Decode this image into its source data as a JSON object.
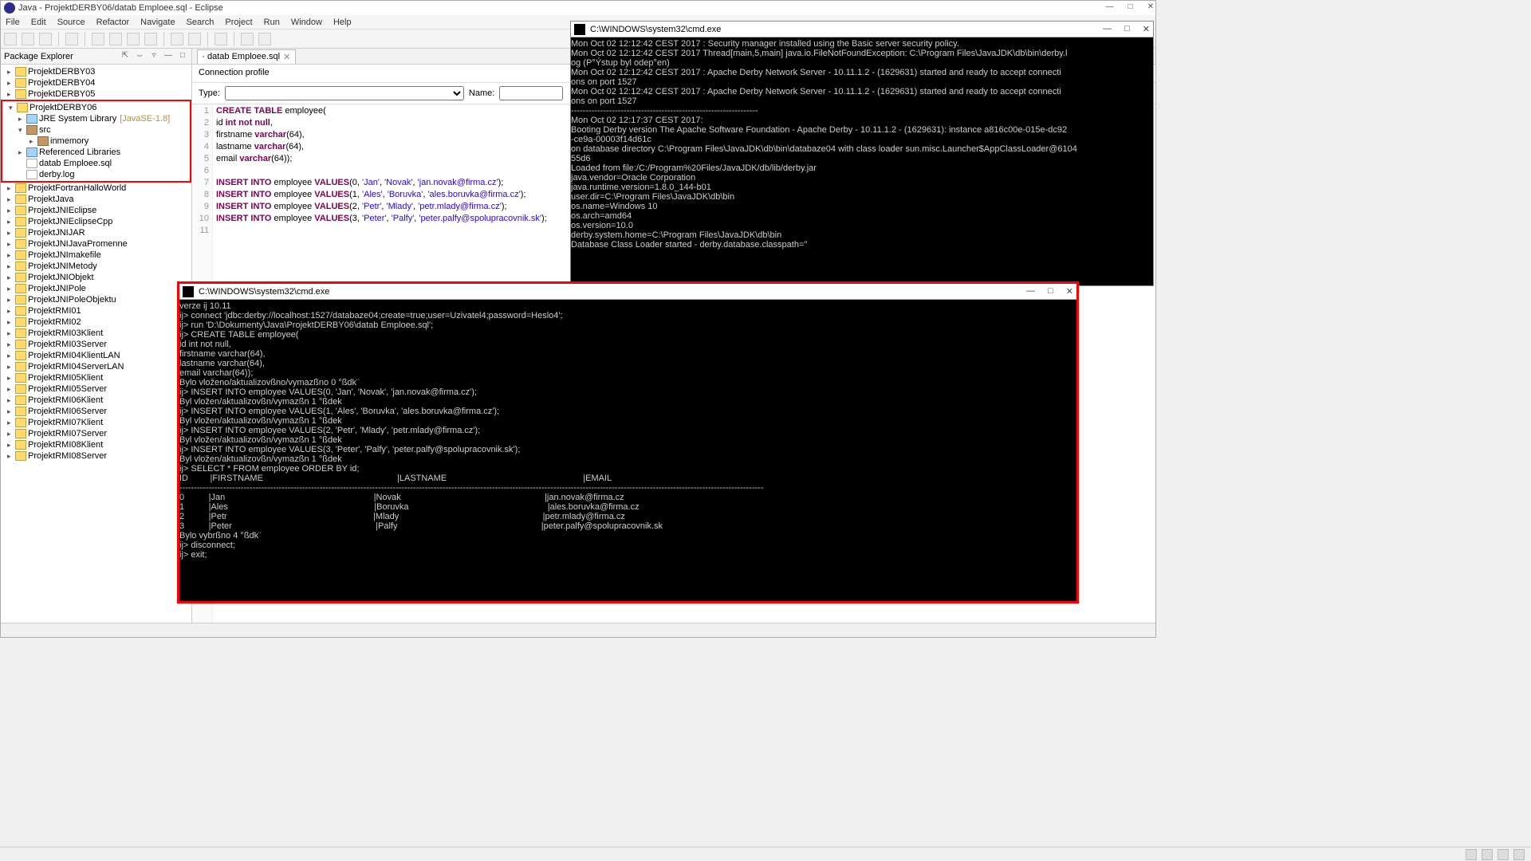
{
  "eclipse": {
    "title": "Java - ProjektDERBY06/datab Emploee.sql - Eclipse",
    "menus": [
      "File",
      "Edit",
      "Source",
      "Refactor",
      "Navigate",
      "Search",
      "Project",
      "Run",
      "Window",
      "Help"
    ],
    "pkgExplorer": {
      "title": "Package Explorer",
      "projects": [
        {
          "name": "ProjektDERBY03"
        },
        {
          "name": "ProjektDERBY04"
        },
        {
          "name": "ProjektDERBY05"
        }
      ],
      "highlighted": {
        "name": "ProjektDERBY06",
        "jre": "JRE System Library",
        "jreVers": "[JavaSE-1.8]",
        "src": "src",
        "pkg": "inmemory",
        "ref": "Referenced Libraries",
        "sql": "datab Emploee.sql",
        "log": "derby.log"
      },
      "rest": [
        "ProjektFortranHalloWorld",
        "ProjektJava",
        "ProjektJNIEclipse",
        "ProjektJNIEclipseCpp",
        "ProjektJNIJAR",
        "ProjektJNIJavaPromenne",
        "ProjektJNImakefile",
        "ProjektJNIMetody",
        "ProjektJNIObjekt",
        "ProjektJNIPole",
        "ProjektJNIPoleObjektu",
        "ProjektRMI01",
        "ProjektRMI02",
        "ProjektRMI03Klient",
        "ProjektRMI03Server",
        "ProjektRMI04KlientLAN",
        "ProjektRMI04ServerLAN",
        "ProjektRMI05Klient",
        "ProjektRMI05Server",
        "ProjektRMI06Klient",
        "ProjektRMI06Server",
        "ProjektRMI07Klient",
        "ProjektRMI07Server",
        "ProjektRMI08Klient",
        "ProjektRMI08Server"
      ]
    },
    "editor": {
      "tabName": "datab Emploee.sql",
      "connProfile": "Connection profile",
      "typeLabel": "Type:",
      "nameLabel": "Name:",
      "code": [
        {
          "n": 1,
          "l": "CREATE TABLE employee("
        },
        {
          "n": 2,
          "l": "id int not null,"
        },
        {
          "n": 3,
          "l": "firstname varchar(64),"
        },
        {
          "n": 4,
          "l": "lastname varchar(64),"
        },
        {
          "n": 5,
          "l": "email varchar(64));"
        },
        {
          "n": 6,
          "l": ""
        },
        {
          "n": 7,
          "l": "INSERT INTO employee VALUES(0, 'Jan', 'Novak', 'jan.novak@firma.cz');"
        },
        {
          "n": 8,
          "l": "INSERT INTO employee VALUES(1, 'Ales', 'Boruvka', 'ales.boruvka@firma.cz');"
        },
        {
          "n": 9,
          "l": "INSERT INTO employee VALUES(2, 'Petr', 'Mlady', 'petr.mlady@firma.cz');"
        },
        {
          "n": 10,
          "l": "INSERT INTO employee VALUES(3, 'Peter', 'Palfy', 'peter.palfy@spolupracovnik.sk');"
        },
        {
          "n": 11,
          "l": ""
        }
      ]
    }
  },
  "termTop": {
    "title": "C:\\WINDOWS\\system32\\cmd.exe",
    "lines": [
      "Mon Oct 02 12:12:42 CEST 2017 : Security manager installed using the Basic server security policy.",
      "Mon Oct 02 12:12:42 CEST 2017 Thread[main,5,main] java.io.FileNotFoundException: C:\\Program Files\\JavaJDK\\db\\bin\\derby.l",
      "og (P°Ýstup byl odep°en)",
      "Mon Oct 02 12:12:42 CEST 2017 : Apache Derby Network Server - 10.11.1.2 - (1629631) started and ready to accept connecti",
      "ons on port 1527",
      "Mon Oct 02 12:12:42 CEST 2017 : Apache Derby Network Server - 10.11.1.2 - (1629631) started and ready to accept connecti",
      "ons on port 1527",
      "----------------------------------------------------------------",
      "Mon Oct 02 12:17:37 CEST 2017:",
      "Booting Derby version The Apache Software Foundation - Apache Derby - 10.11.1.2 - (1629631): instance a816c00e-015e-dc92",
      "-ce9a-00003f14d61c",
      "on database directory C:\\Program Files\\JavaJDK\\db\\bin\\databaze04 with class loader sun.misc.Launcher$AppClassLoader@6104",
      "55d6",
      "Loaded from file:/C:/Program%20Files/JavaJDK/db/lib/derby.jar",
      "java.vendor=Oracle Corporation",
      "java.runtime.version=1.8.0_144-b01",
      "user.dir=C:\\Program Files\\JavaJDK\\db\\bin",
      "os.name=Windows 10",
      "os.arch=amd64",
      "os.version=10.0",
      "derby.system.home=C:\\Program Files\\JavaJDK\\db\\bin",
      "Database Class Loader started - derby.database.classpath=''"
    ]
  },
  "termBot": {
    "title": "C:\\WINDOWS\\system32\\cmd.exe",
    "lines": [
      "verze ij 10.11",
      "ij> connect 'jdbc:derby://localhost:1527/databaze04;create=true;user=Uzivatel4;password=Heslo4';",
      "ij> run 'D:\\Dokumenty\\Java\\ProjektDERBY06\\datab Emploee.sql';",
      "ij> CREATE TABLE employee(",
      "id int not null,",
      "firstname varchar(64),",
      "lastname varchar(64),",
      "email varchar(64));",
      "Bylo vloženo/aktualizovßno/vymazßno 0 °ßdk¨",
      "ij> INSERT INTO employee VALUES(0, 'Jan', 'Novak', 'jan.novak@firma.cz');",
      "Byl vložen/aktualizovßn/vymazßn 1 °ßdek",
      "ij> INSERT INTO employee VALUES(1, 'Ales', 'Boruvka', 'ales.boruvka@firma.cz');",
      "Byl vložen/aktualizovßn/vymazßn 1 °ßdek",
      "ij> INSERT INTO employee VALUES(2, 'Petr', 'Mlady', 'petr.mlady@firma.cz');",
      "Byl vložen/aktualizovßn/vymazßn 1 °ßdek",
      "ij> INSERT INTO employee VALUES(3, 'Peter', 'Palfy', 'peter.palfy@spolupracovnik.sk');",
      "Byl vložen/aktualizovßn/vymazßn 1 °ßdek",
      "ij> SELECT * FROM employee ORDER BY id;",
      "ID         |FIRSTNAME                                                       |LASTNAME                                                        |EMAIL",
      "--------------------------------------------------------------------------------------------------------------------------------------------------------------------------------------------------------",
      "0          |Jan                                                             |Novak                                                           |jan.novak@firma.cz",
      "1          |Ales                                                            |Boruvka                                                         |ales.boruvka@firma.cz",
      "2          |Petr                                                            |Mlady                                                           |petr.mlady@firma.cz",
      "3          |Peter                                                           |Palfy                                                           |peter.palfy@spolupracovnik.sk",
      "",
      "Bylo vybrßno 4 °ßdk¨",
      "ij> disconnect;",
      "ij> exit;"
    ]
  }
}
